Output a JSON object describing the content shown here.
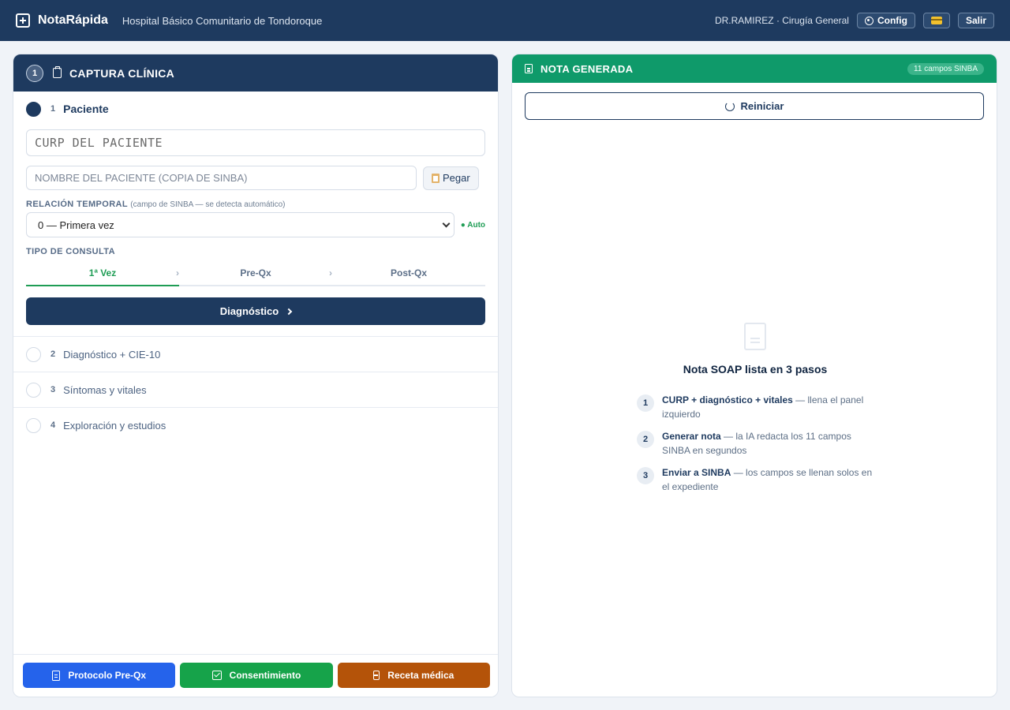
{
  "topbar": {
    "brand": "NotaRápida",
    "hospital": "Hospital Básico Comunitario de Tondoroque",
    "user": "DR.RAMIREZ · Cirugía General",
    "config_label": "Config",
    "logout_label": "Salir"
  },
  "left": {
    "step_badge": "1",
    "title": "CAPTURA CLÍNICA",
    "steps": [
      {
        "num": "1",
        "label": "Paciente"
      },
      {
        "num": "2",
        "label": "Diagnóstico + CIE-10"
      },
      {
        "num": "3",
        "label": "Síntomas y vitales"
      },
      {
        "num": "4",
        "label": "Exploración y estudios"
      }
    ],
    "curp_placeholder": "CURP DEL PACIENTE",
    "name_placeholder": "NOMBRE DEL PACIENTE (COPIA DE SINBA)",
    "paste_label": "Pegar",
    "relation_label": "RELACIÓN TEMPORAL",
    "relation_hint": "(campo de SINBA — se detecta automático)",
    "relation_value": "0 — Primera vez",
    "auto_tag": "● Auto",
    "consult_label": "TIPO DE CONSULTA",
    "tabs": [
      "1ª Vez",
      "Pre-Qx",
      "Post-Qx"
    ],
    "tab_separator": "›",
    "next_label": "Diagnóstico",
    "bottom": {
      "protocol": "Protocolo Pre-Qx",
      "consent": "Consentimiento",
      "prescription": "Receta médica"
    }
  },
  "right": {
    "title": "NOTA GENERADA",
    "badge": "11 campos SINBA",
    "reset_label": "Reiniciar",
    "empty_title": "Nota SOAP lista en 3 pasos",
    "steps": [
      {
        "num": "1",
        "bold": "CURP + diagnóstico + vitales",
        "text": " — llena el panel izquierdo"
      },
      {
        "num": "2",
        "bold": "Generar nota",
        "text": " — la IA redacta los 11 campos SINBA en segundos"
      },
      {
        "num": "3",
        "bold": "Enviar a SINBA",
        "text": " — los campos se llenan solos en el expediente"
      }
    ]
  },
  "colors": {
    "navy": "#1e3a5f",
    "green": "#0f9a6a",
    "accent_green": "#1f9d55",
    "blue_button": "#2563eb",
    "green_button": "#16a34a",
    "orange_button": "#b45309"
  },
  "icons": [
    "add-note-icon",
    "gear-icon",
    "card-icon",
    "clipboard-icon",
    "document-icon",
    "checkbox-icon",
    "pill-bottle-icon",
    "refresh-icon",
    "chevron-right-icon",
    "chevron-down-icon"
  ]
}
